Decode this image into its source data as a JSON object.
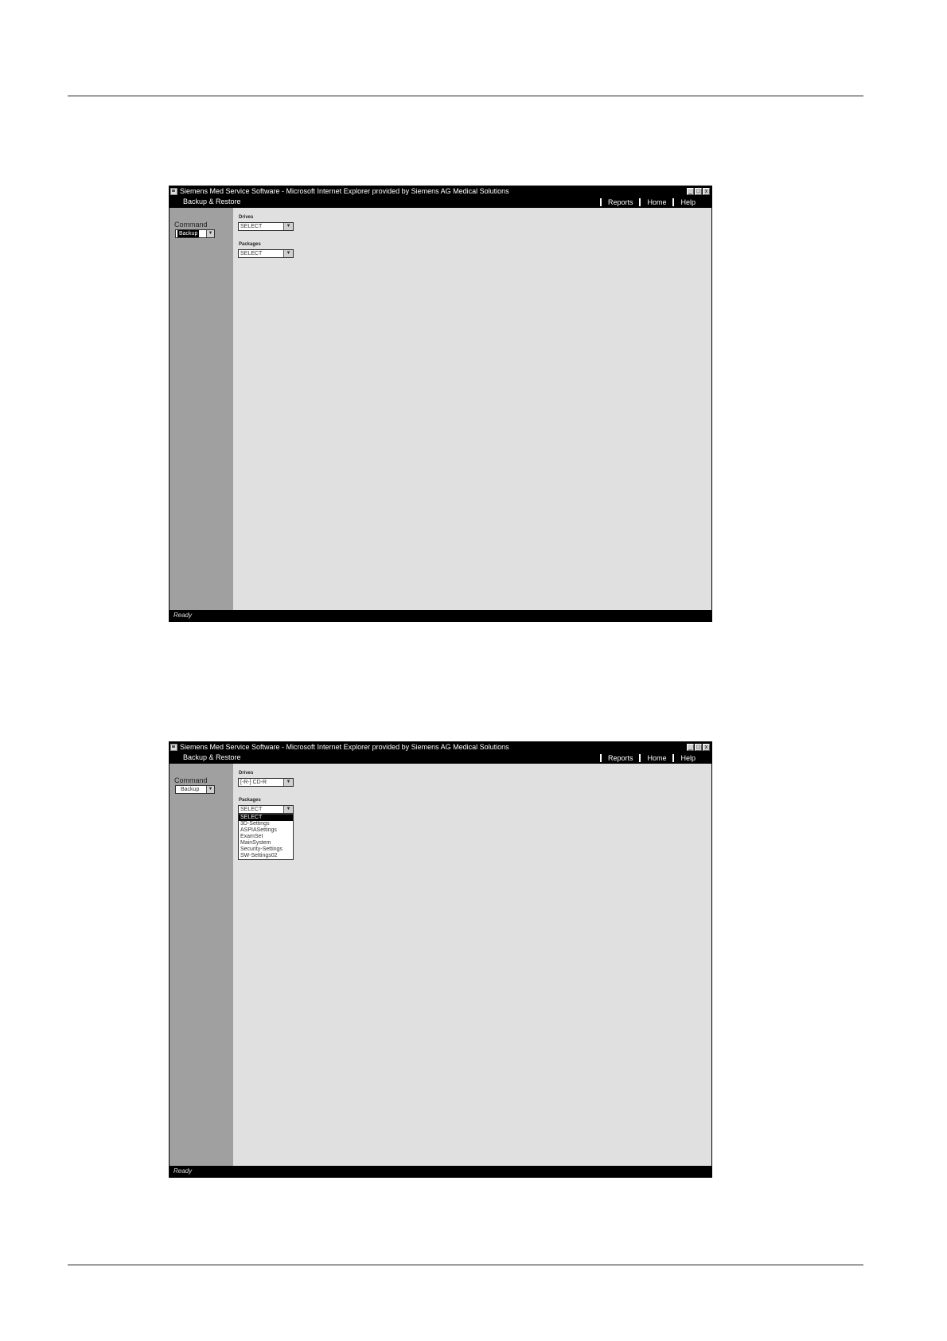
{
  "window_title": "Siemens Med Service Software - Microsoft Internet Explorer provided by Siemens AG Medical Solutions",
  "section_title": "Backup & Restore",
  "nav_links": [
    "Reports",
    "Home",
    "Help"
  ],
  "window_buttons": [
    "_",
    "□",
    "x"
  ],
  "command_label": "Command",
  "command_value": "Backup",
  "drives_label": "Drives",
  "packages_label": "Packages",
  "status_text": "Ready",
  "screen1": {
    "drives_value": "SELECT",
    "packages_value": "SELECT"
  },
  "screen2": {
    "drives_value": "[-R-] CD-R",
    "packages_value": "SELECT",
    "package_options": [
      "SELECT",
      "3D-Settings",
      "ASPIASettings",
      "ExamSet",
      "MainSystem",
      "Security-Settings",
      "SW-Settings02"
    ],
    "selected_option": "SELECT"
  },
  "icons": [
    "ie-page-icon",
    "minimize-icon",
    "maximize-icon",
    "close-icon",
    "chevron-down-icon"
  ]
}
